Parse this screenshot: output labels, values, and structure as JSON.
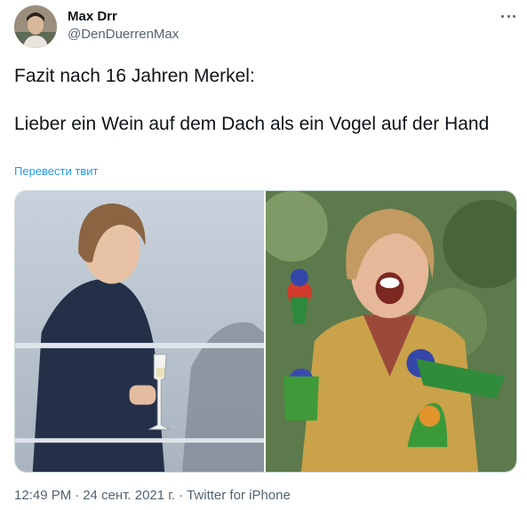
{
  "author": {
    "name": "Max Drr",
    "handle": "@DenDuerrenMax",
    "avatar_icon": "profile-photo"
  },
  "more_icon": "more-horizontal-icon",
  "tweet": {
    "line1": "Fazit nach 16 Jahren Merkel:",
    "line2": "Lieber ein Wein auf dem Dach als ein Vogel auf der Hand",
    "translate_label": "Перевести твит"
  },
  "media": {
    "photo_count": 2
  },
  "meta": {
    "time": "12:49 PM",
    "separator": "·",
    "date": "24 сент. 2021 г.",
    "source": "Twitter for iPhone"
  },
  "colors": {
    "link": "#1d9bf0",
    "secondary_text": "#536471",
    "primary_text": "#0f1419"
  }
}
